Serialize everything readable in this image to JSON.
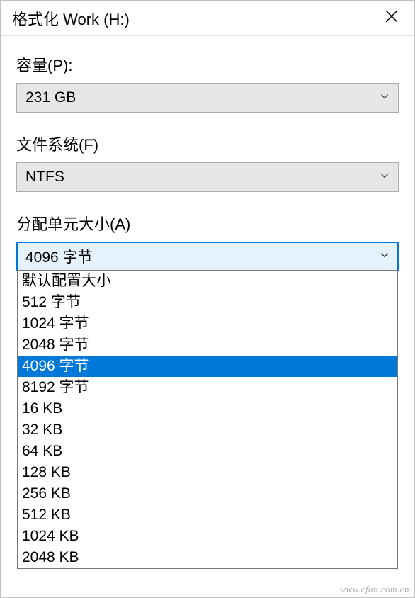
{
  "titlebar": {
    "title": "格式化 Work (H:)"
  },
  "capacity": {
    "label": "容量(P):",
    "value": "231 GB"
  },
  "filesystem": {
    "label": "文件系统(F)",
    "value": "NTFS"
  },
  "allocation": {
    "label": "分配单元大小(A)",
    "value": "4096 字节",
    "options": [
      "默认配置大小",
      "512 字节",
      "1024 字节",
      "2048 字节",
      "4096 字节",
      "8192 字节",
      "16 KB",
      "32 KB",
      "64 KB",
      "128 KB",
      "256 KB",
      "512 KB",
      "1024 KB",
      "2048 KB"
    ],
    "selected_index": 4
  },
  "watermark": "www.cfan.com.cn"
}
